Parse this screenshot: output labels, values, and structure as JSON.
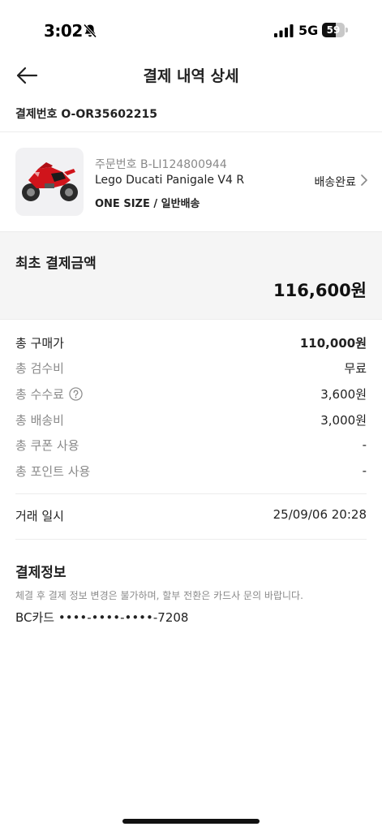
{
  "status_bar": {
    "time": "3:02",
    "network": "5G",
    "battery_level": "59",
    "battery_fraction": 0.59,
    "icons": [
      "bell-slash-icon",
      "signal-icon",
      "battery-icon"
    ]
  },
  "header": {
    "title": "결제 내역 상세",
    "back_icon": "arrow-left-icon"
  },
  "payment_number": "결제번호 O-OR35602215",
  "product": {
    "order_number": "주문번호 B-LI124800944",
    "name": "Lego Ducati Panigale V4 R",
    "option": "ONE SIZE / 일반배송",
    "status": "배송완료",
    "image_icon": "motorcycle-image"
  },
  "total": {
    "label": "최초 결제금액",
    "amount": "116,600원"
  },
  "breakdown": [
    {
      "label": "총 구매가",
      "value": "110,000원"
    },
    {
      "label": "총 검수비",
      "value": "무료"
    },
    {
      "label": "총 수수료",
      "value": "3,600원"
    },
    {
      "label": "총 배송비",
      "value": "3,000원"
    },
    {
      "label": "총 쿠폰 사용",
      "value": "-"
    },
    {
      "label": "총 포인트 사용",
      "value": "-"
    }
  ],
  "transaction": {
    "label": "거래 일시",
    "value": "25/09/06 20:28"
  },
  "payment_info": {
    "title": "결제정보",
    "notice": "체결 후 결제 정보 변경은 불가하며, 할부 전환은 카드사 문의 바랍니다.",
    "card": "BC카드 ••••-••••-••••-7208"
  },
  "colors": {
    "text_primary": "#222222",
    "text_secondary": "#8a8a8a",
    "section_bg": "#f5f5f5",
    "divider": "#ececec"
  }
}
